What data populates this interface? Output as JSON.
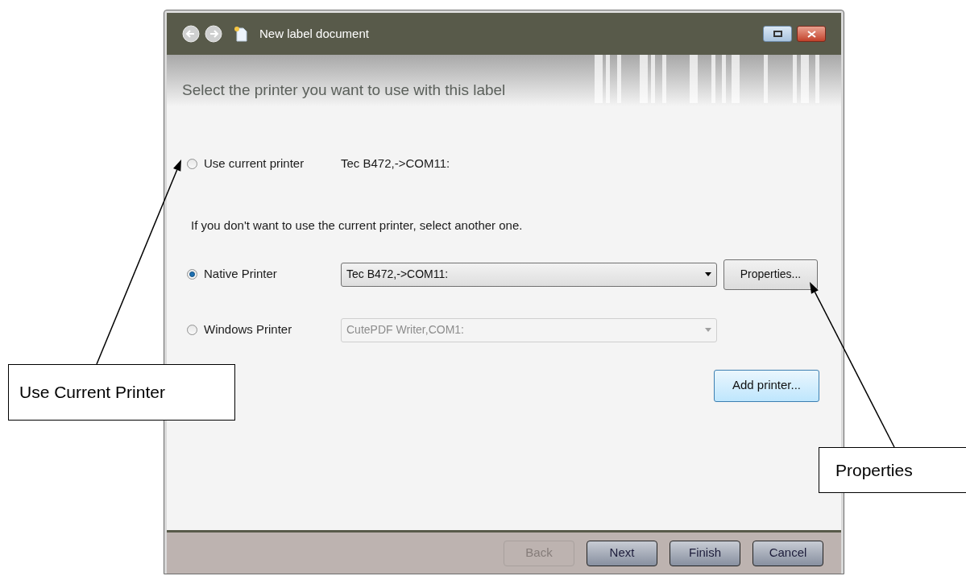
{
  "window": {
    "title": "New label document"
  },
  "heading": "Select the printer you want to use with this label",
  "current_printer": {
    "label": "Use current printer",
    "value": "Tec B472,->COM11:",
    "selected": false
  },
  "hint": "If you don't want to use the current printer, select another one.",
  "printers": [
    {
      "label": "Native Printer",
      "value": "Tec B472,->COM11:",
      "selected": true,
      "disabled": false
    },
    {
      "label": "Windows Printer",
      "value": "CutePDF Writer,COM1:",
      "selected": false,
      "disabled": true
    }
  ],
  "properties_button": "Properties...",
  "add_printer_button": "Add printer...",
  "footer_buttons": [
    {
      "label": "Back",
      "disabled": true
    },
    {
      "label": "Next",
      "disabled": false
    },
    {
      "label": "Finish",
      "disabled": false
    },
    {
      "label": "Cancel",
      "disabled": false
    }
  ],
  "callouts": [
    {
      "text": "Use Current Printer"
    },
    {
      "text": "Properties"
    }
  ]
}
